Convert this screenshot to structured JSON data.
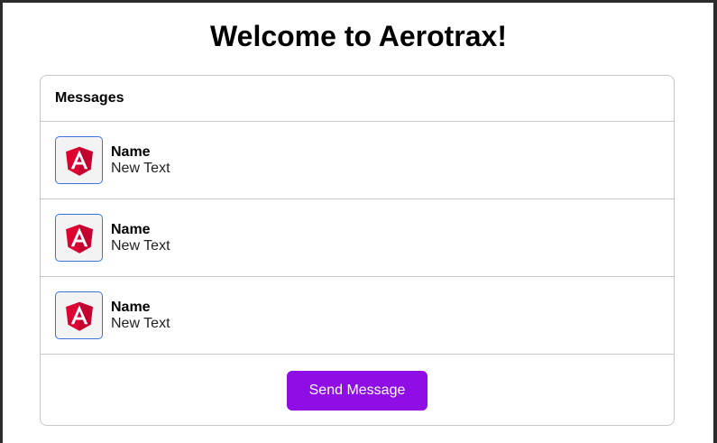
{
  "page": {
    "title": "Welcome to Aerotrax!"
  },
  "card": {
    "header": "Messages"
  },
  "messages": [
    {
      "name": "Name",
      "text": "New Text",
      "avatar_icon": "angular-logo-icon"
    },
    {
      "name": "Name",
      "text": "New Text",
      "avatar_icon": "angular-logo-icon"
    },
    {
      "name": "Name",
      "text": "New Text",
      "avatar_icon": "angular-logo-icon"
    }
  ],
  "actions": {
    "send_label": "Send Message"
  },
  "colors": {
    "accent": "#8f0ee6",
    "avatar_border": "#3b73d9",
    "angular_red": "#dd0031",
    "angular_dark_red": "#c3002f"
  }
}
